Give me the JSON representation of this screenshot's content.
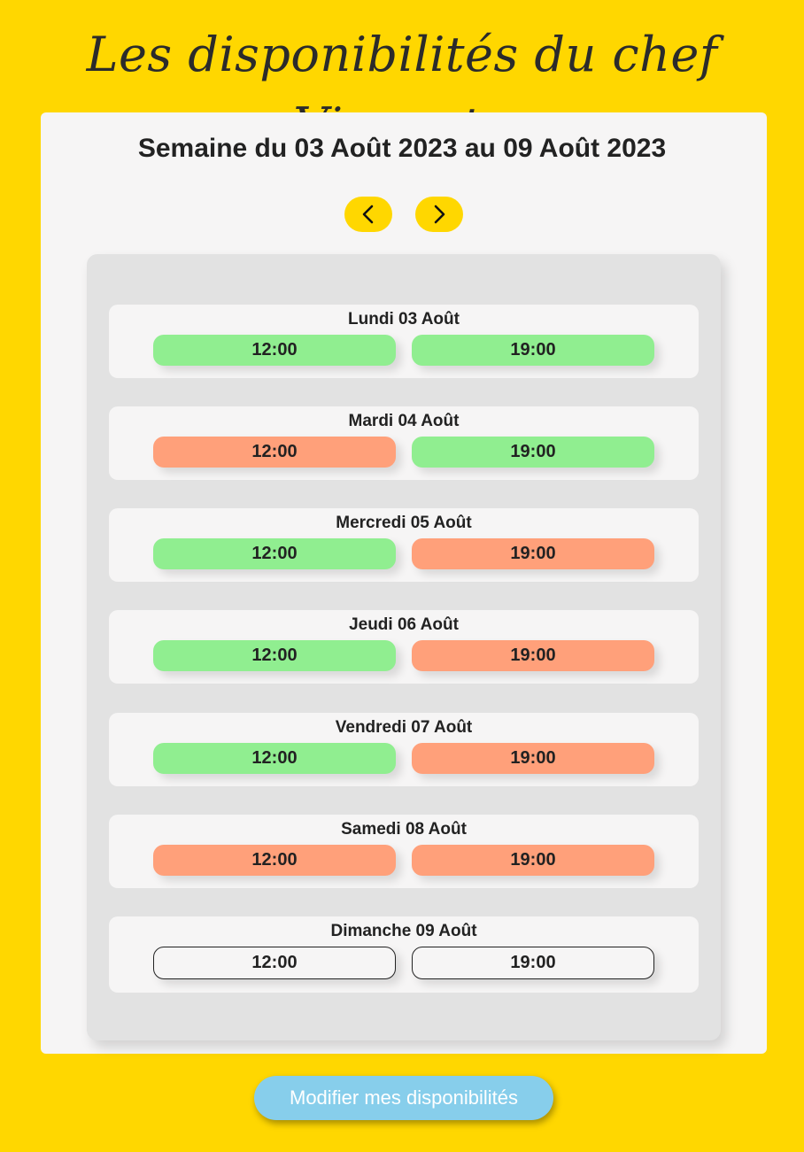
{
  "page_title": "Les disponibilités du chef Vincento",
  "week_title": "Semaine du 03 Août 2023 au 09 Août 2023",
  "nav": {
    "prev_icon": "chevron-left-icon",
    "next_icon": "chevron-right-icon"
  },
  "colors": {
    "background": "#FFD700",
    "available": "#90EE90",
    "unavailable": "#FFA07A",
    "button": "#87CEEB"
  },
  "days": [
    {
      "label": "Lundi 03 Août",
      "slots": [
        {
          "time": "12:00",
          "status": "available"
        },
        {
          "time": "19:00",
          "status": "available"
        }
      ]
    },
    {
      "label": "Mardi 04 Août",
      "slots": [
        {
          "time": "12:00",
          "status": "unavailable"
        },
        {
          "time": "19:00",
          "status": "available"
        }
      ]
    },
    {
      "label": "Mercredi 05 Août",
      "slots": [
        {
          "time": "12:00",
          "status": "available"
        },
        {
          "time": "19:00",
          "status": "unavailable"
        }
      ]
    },
    {
      "label": "Jeudi 06 Août",
      "slots": [
        {
          "time": "12:00",
          "status": "available"
        },
        {
          "time": "19:00",
          "status": "unavailable"
        }
      ]
    },
    {
      "label": "Vendredi 07 Août",
      "slots": [
        {
          "time": "12:00",
          "status": "available"
        },
        {
          "time": "19:00",
          "status": "unavailable"
        }
      ]
    },
    {
      "label": "Samedi 08 Août",
      "slots": [
        {
          "time": "12:00",
          "status": "unavailable"
        },
        {
          "time": "19:00",
          "status": "unavailable"
        }
      ]
    },
    {
      "label": "Dimanche 09 Août",
      "slots": [
        {
          "time": "12:00",
          "status": "unset"
        },
        {
          "time": "19:00",
          "status": "unset"
        }
      ]
    }
  ],
  "modify_button": "Modifier mes disponibilités"
}
